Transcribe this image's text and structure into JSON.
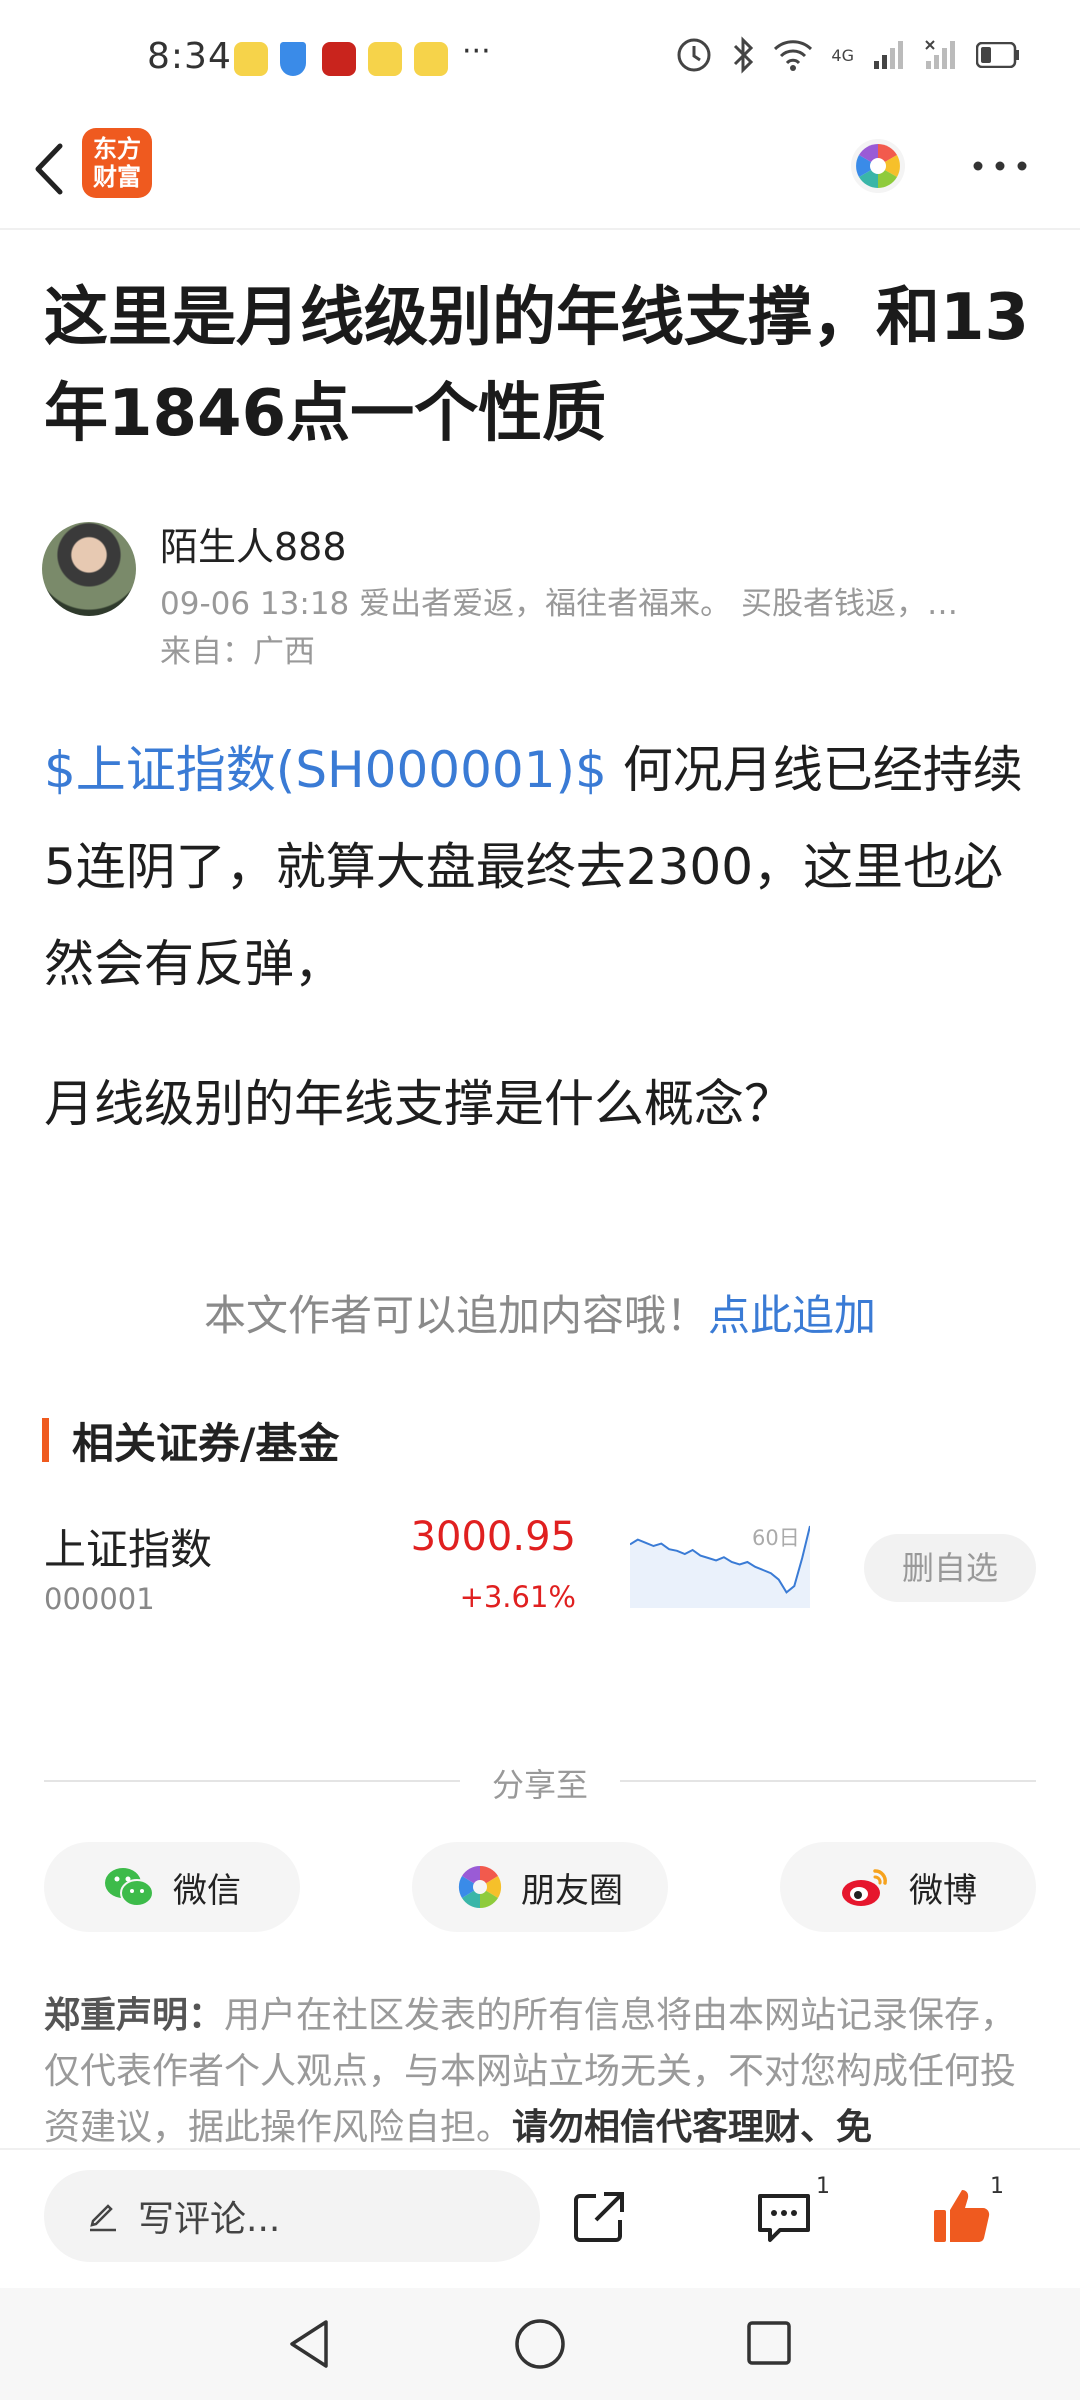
{
  "status_bar": {
    "time": "8:34",
    "signal": "4G",
    "more_indicator": "···"
  },
  "nav": {
    "app_logo_line1": "东方",
    "app_logo_line2": "财富"
  },
  "article": {
    "title": "这里是月线级别的年线支撑，和13年1846点一个性质",
    "author": "陌生人888",
    "meta": "09-06 13:18 爱出者爱返，福往者福来。 买股者钱返，…",
    "location": "来自：广西",
    "stock_link": "$上证指数(SH000001)$",
    "body_1": " 何况月线已经持续5连阴了，就算大盘最终去2300，这里也必然会有反弹，",
    "body_2": "月线级别的年线支撑是什么概念？"
  },
  "append": {
    "text": "本文作者可以追加内容哦！",
    "link": "点此追加"
  },
  "related": {
    "section_title": "相关证券/基金",
    "fund": {
      "name": "上证指数",
      "code": "000001",
      "price": "3000.95",
      "change": "+3.61%",
      "sparkline_label": "60日",
      "sparkline_values": [
        0.72,
        0.78,
        0.74,
        0.7,
        0.73,
        0.66,
        0.64,
        0.6,
        0.65,
        0.58,
        0.55,
        0.52,
        0.56,
        0.5,
        0.47,
        0.5,
        0.44,
        0.4,
        0.36,
        0.28,
        0.12,
        0.2,
        0.55,
        0.95
      ],
      "remove_button": "删自选"
    }
  },
  "share": {
    "label": "分享至",
    "wechat": "微信",
    "moments": "朋友圈",
    "weibo": "微博"
  },
  "disclaimer": {
    "heading": "郑重声明：",
    "text": "用户在社区发表的所有信息将由本网站记录保存，仅代表作者个人观点，与本网站立场无关，不对您构成任何投资建议，据此操作风险自担。",
    "strong": "请勿相信代客理财、免"
  },
  "comment_bar": {
    "placeholder": "写评论...",
    "comment_count": "1",
    "like_count": "1"
  },
  "colors": {
    "accent": "#ef5a1f",
    "link": "#3a7bd5",
    "up": "#e02020",
    "like": "#ef5a1f"
  }
}
